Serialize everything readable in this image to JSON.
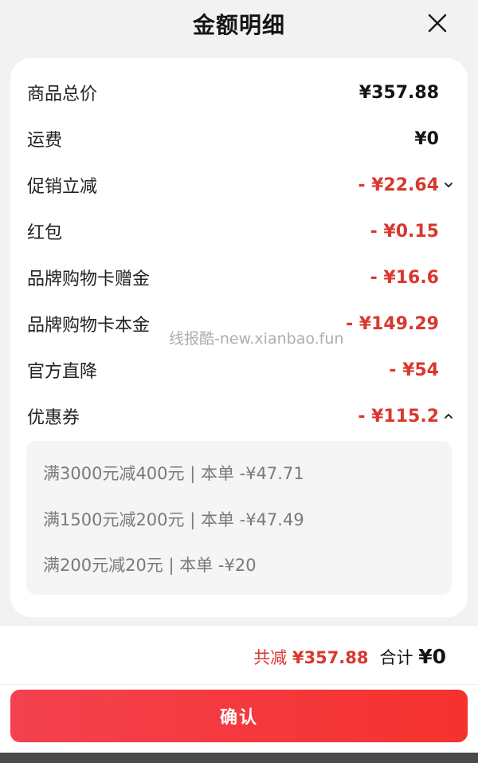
{
  "header": {
    "title": "金额明细",
    "close_icon": "close-icon"
  },
  "rows": [
    {
      "label": "商品总价",
      "value": "¥357.88",
      "color": "#141414"
    },
    {
      "label": "运费",
      "value": "¥0",
      "color": "#141414"
    },
    {
      "label": "促销立减",
      "value": "- ¥22.64",
      "color": "#d8382e",
      "icon": "chevron-down-icon"
    },
    {
      "label": "红包",
      "value": "- ¥0.15",
      "color": "#d8382e"
    },
    {
      "label": "品牌购物卡赠金",
      "value": "- ¥16.6",
      "color": "#d8382e"
    },
    {
      "label": "品牌购物卡本金",
      "value": "- ¥149.29",
      "color": "#d8382e"
    },
    {
      "label": "官方直降",
      "value": "- ¥54",
      "color": "#d8382e"
    },
    {
      "label": "优惠券",
      "value": "- ¥115.2",
      "color": "#d8382e",
      "icon": "chevron-up-icon"
    }
  ],
  "coupons": [
    "满3000元减400元 | 本单 -¥47.71",
    "满1500元减200元 | 本单 -¥47.49",
    "满200元减20元 | 本单 -¥20"
  ],
  "watermark": "线报酷-new.xianbao.fun",
  "footer": {
    "reduce_label": "共减",
    "reduce_value": "¥357.88",
    "total_label": "合计",
    "total_value": "¥0"
  },
  "confirm_label": "确认",
  "colors": {
    "accent": "#d8382e",
    "button_gradient_start": "#f3414f",
    "button_gradient_end": "#f5322e"
  }
}
